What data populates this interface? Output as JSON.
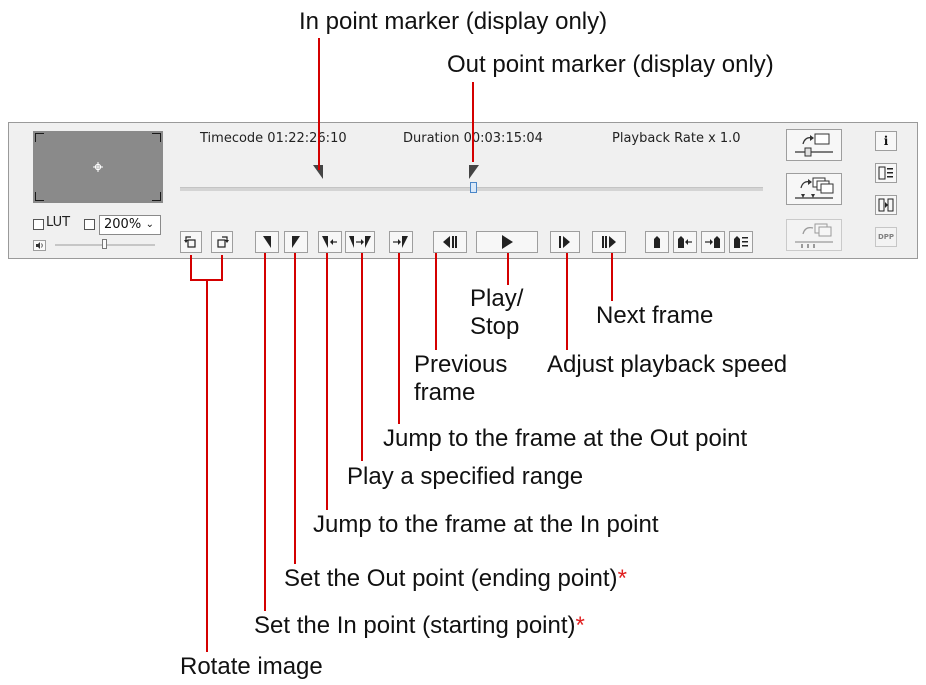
{
  "annotations": {
    "in_point_marker": "In point marker (display only)",
    "out_point_marker": "Out point marker (display only)",
    "play_stop": [
      "Play/",
      "Stop"
    ],
    "next_frame": "Next frame",
    "previous_frame": [
      "Previous",
      "frame"
    ],
    "adjust_speed": "Adjust playback speed",
    "jump_out": "Jump to the frame at the Out point",
    "play_range": "Play a specified range",
    "jump_in": "Jump to the frame at the In point",
    "set_out": "Set the Out point (ending point)",
    "set_in": "Set the In point (starting point)",
    "asterisk": "*",
    "rotate": "Rotate image"
  },
  "player": {
    "timecode": "Timecode 01:22:26:10",
    "duration": "Duration 00:03:15:04",
    "playback_rate": "Playback Rate x 1.0",
    "lut_label": "LUT",
    "zoom_value": "200%",
    "info_glyph": "i",
    "dpp_label": "DPP"
  },
  "icons": {
    "preview": "focus-crosshair-icon",
    "volume": "speaker-icon",
    "rotate_left": "rotate-left-icon",
    "rotate_right": "rotate-right-icon",
    "play": "play-icon"
  },
  "colors": {
    "annotation_line": "#d40000",
    "asterisk": "#e02020",
    "panel_bg": "#f0f0f0",
    "preview_bg": "#8a8a8a",
    "position_marker": "#4a86c8"
  }
}
